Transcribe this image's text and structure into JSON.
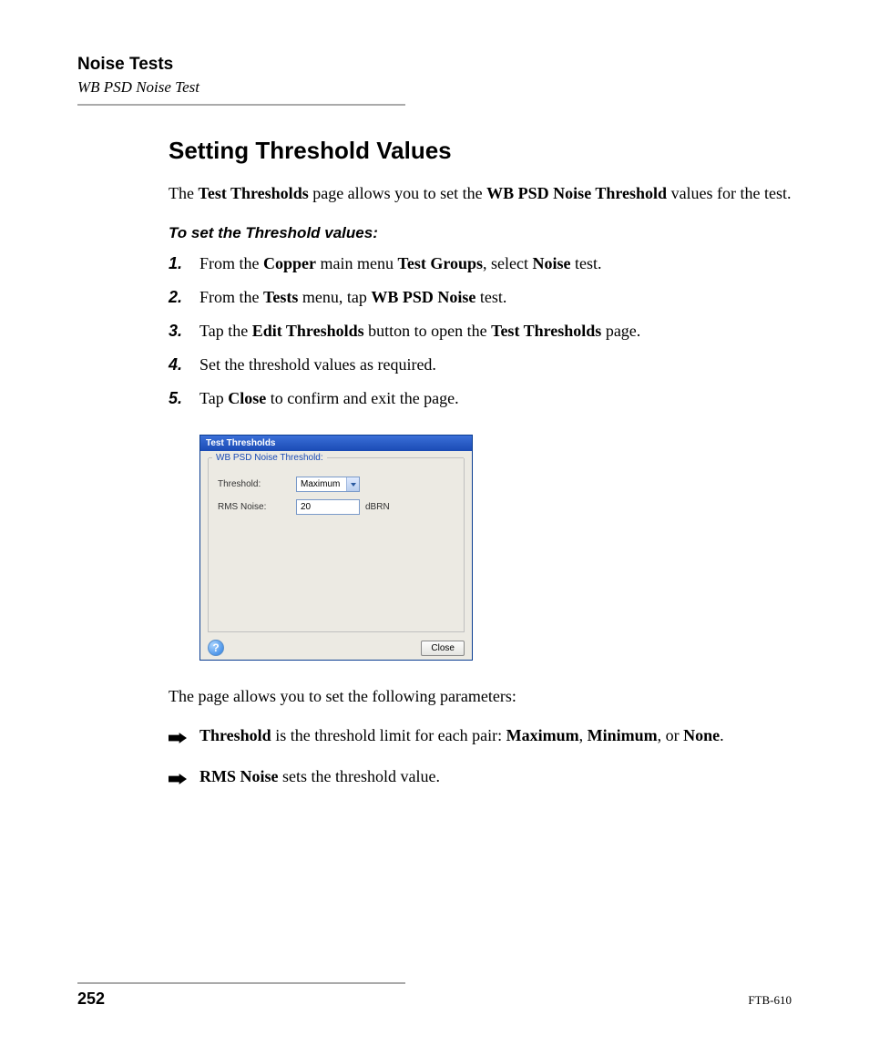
{
  "header": {
    "title": "Noise Tests",
    "subtitle": "WB PSD Noise Test"
  },
  "section_heading": "Setting Threshold Values",
  "intro": {
    "t1": "The ",
    "b1": "Test Thresholds",
    "t2": " page allows you to set the ",
    "b2": "WB PSD Noise Threshold",
    "t3": " values for the test."
  },
  "sub_heading": "To set the Threshold values:",
  "steps": [
    {
      "num": "1.",
      "parts": [
        "From the ",
        "Copper",
        " main menu ",
        "Test Groups",
        ", select ",
        "Noise",
        " test."
      ]
    },
    {
      "num": "2.",
      "parts": [
        "From the ",
        "Tests",
        " menu, tap ",
        "WB PSD Noise",
        " test."
      ]
    },
    {
      "num": "3.",
      "parts": [
        "Tap the ",
        "Edit Thresholds",
        " button to open the ",
        "Test Thresholds",
        " page."
      ]
    },
    {
      "num": "4.",
      "parts": [
        "Set the threshold values as required."
      ]
    },
    {
      "num": "5.",
      "parts": [
        "Tap ",
        "Close",
        " to confirm and exit the page."
      ]
    }
  ],
  "dialog": {
    "title": "Test Thresholds",
    "legend": "WB PSD Noise Threshold:",
    "threshold_label": "Threshold:",
    "threshold_value": "Maximum",
    "rms_label": "RMS Noise:",
    "rms_value": "20",
    "rms_unit": "dBRN",
    "help_glyph": "?",
    "close_label": "Close"
  },
  "after_para": "The page allows you to set the following parameters:",
  "bullets": [
    {
      "parts": [
        "Threshold",
        " is the threshold limit for each pair: ",
        "Maximum",
        ", ",
        "Minimum",
        ", or ",
        "None",
        "."
      ]
    },
    {
      "parts": [
        "RMS Noise",
        " sets the threshold value."
      ]
    }
  ],
  "footer": {
    "page_number": "252",
    "doc_id": "FTB-610"
  }
}
